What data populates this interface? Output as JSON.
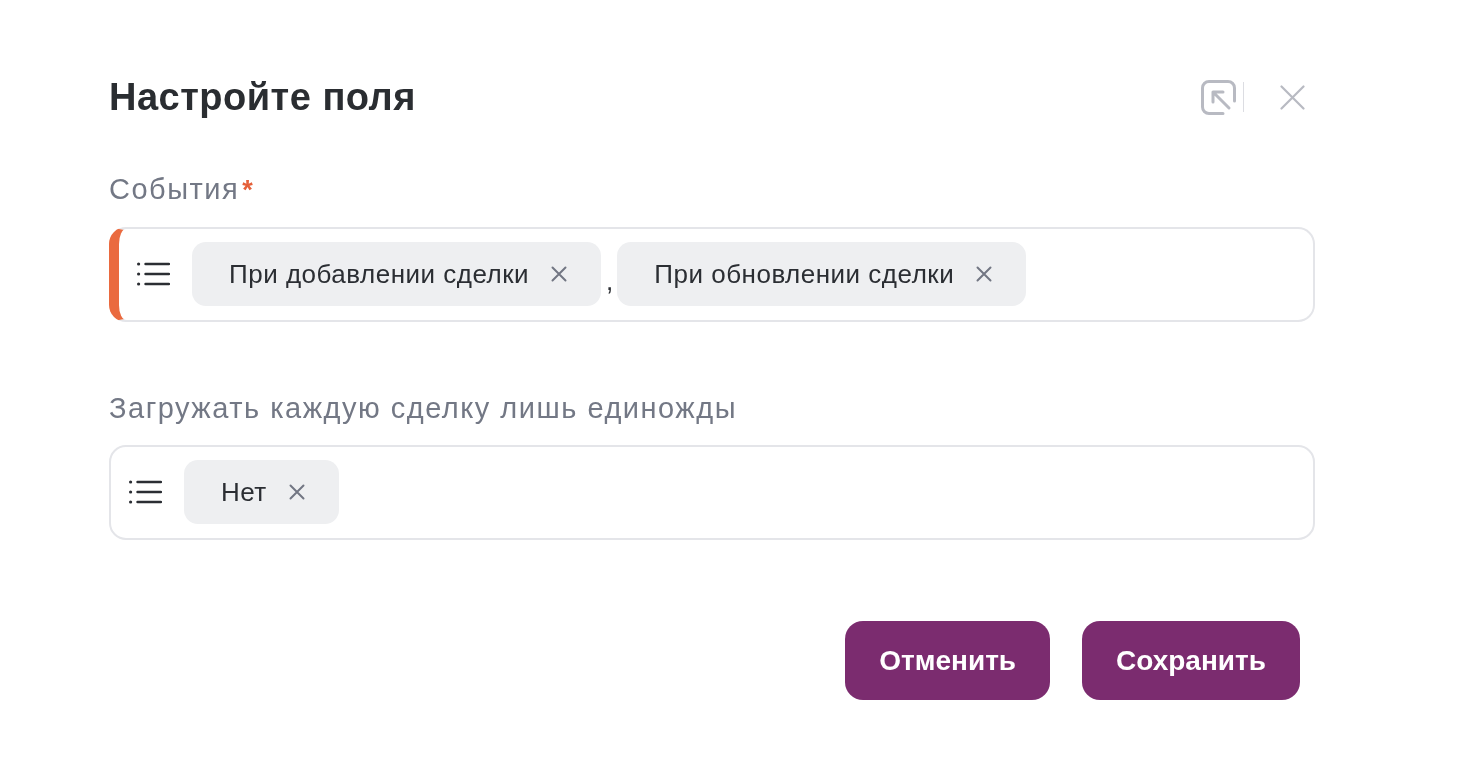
{
  "dialog": {
    "title": "Настройте поля"
  },
  "fields": [
    {
      "label": "События",
      "required_mark": "*",
      "invalid": true,
      "separator": ",",
      "chips": [
        {
          "text": "При добавлении сделки"
        },
        {
          "text": "При обновлении сделки"
        }
      ]
    },
    {
      "label": "Загружать каждую сделку лишь единожды",
      "invalid": false,
      "chips": [
        {
          "text": "Нет"
        }
      ]
    }
  ],
  "buttons": [
    {
      "label": "Отменить"
    },
    {
      "label": "Сохранить"
    }
  ]
}
